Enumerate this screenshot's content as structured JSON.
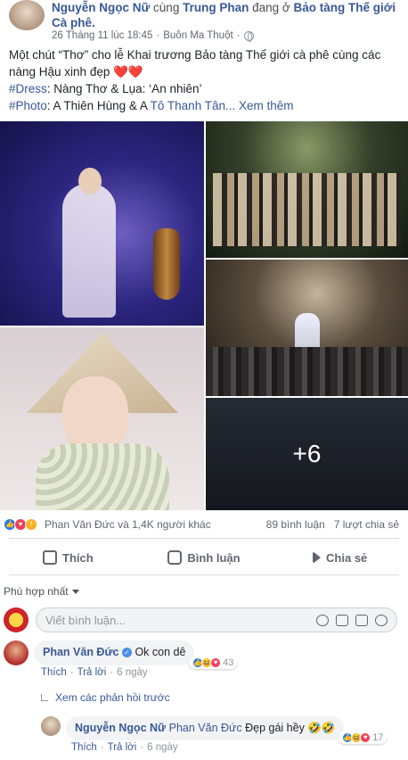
{
  "post": {
    "author": "Nguyễn Ngọc Nữ",
    "with_text": "cùng",
    "tagged": "Trung Phan",
    "at_text": "đang ở",
    "place": "Bảo tàng Thế giới Cà phê.",
    "timestamp": "26 Tháng 11 lúc 18:45",
    "dot": "·",
    "location": "Buôn Ma Thuột",
    "caption_line1": "Một chút “Thơ” cho lễ Khai trương Bảo tàng Thế giới cà phê cùng các nàng Hậu xinh đẹp",
    "hearts": "❤️❤️",
    "dress_tag": "#Dress",
    "dress_text": ": Nàng Thơ & Lụa: ‘An nhiên’",
    "photo_tag": "#Photo",
    "photo_text": ": A Thiên Hùng & A",
    "photo_link": "Tô Thanh Tân...",
    "see_more": "Xem thêm",
    "more_photos": "+6"
  },
  "stats": {
    "reactors": "Phan Văn Đức và 1,4K người khác",
    "comments": "89 bình luận",
    "shares": "7 lượt chia sẻ"
  },
  "actions": {
    "like": "Thích",
    "comment": "Bình luận",
    "share": "Chia sẻ"
  },
  "sort": {
    "label": "Phù hợp nhất"
  },
  "composer": {
    "placeholder": "Viết bình luận..."
  },
  "comments": [
    {
      "author": "Phan Văn Đức",
      "text": "Ok con dê",
      "reaction_count": "43",
      "like": "Thích",
      "reply": "Trả lời",
      "time": "6 ngày"
    }
  ],
  "view_previous": "Xem các phản hồi trước",
  "reply": {
    "author": "Nguyễn Ngọc Nữ",
    "mention": "Phan Văn Đức",
    "text": "Đẹp gái hềy 🤣🤣",
    "reaction_count": "17",
    "like": "Thích",
    "reply": "Trả lời",
    "time": "6 ngày"
  },
  "colors": {
    "link": "#385898",
    "like": "#2078f4",
    "love": "#f33e58"
  },
  "icons": [
    "globe-icon",
    "like-icon",
    "comment-icon",
    "share-icon",
    "emoji-icon",
    "camera-icon",
    "gif-icon",
    "sticker-icon"
  ]
}
